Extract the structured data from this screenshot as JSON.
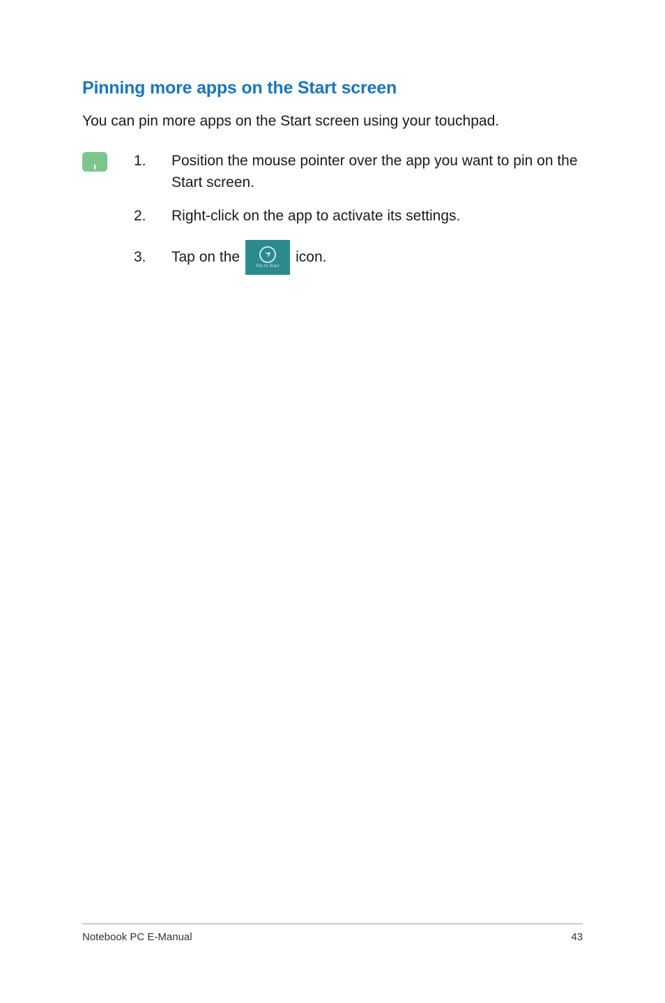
{
  "heading": "Pinning more apps on the Start screen",
  "intro": "You can pin more apps on the Start screen using your touchpad.",
  "steps": [
    {
      "number": "1.",
      "text": "Position the mouse pointer over the app you want to pin on the Start screen."
    },
    {
      "number": "2.",
      "text": "Right-click on the app to activate its settings."
    },
    {
      "number": "3.",
      "text_before": "Tap on the",
      "text_after": "icon.",
      "icon_label": "Pin to Start"
    }
  ],
  "footer": {
    "title": "Notebook PC E-Manual",
    "page": "43"
  }
}
